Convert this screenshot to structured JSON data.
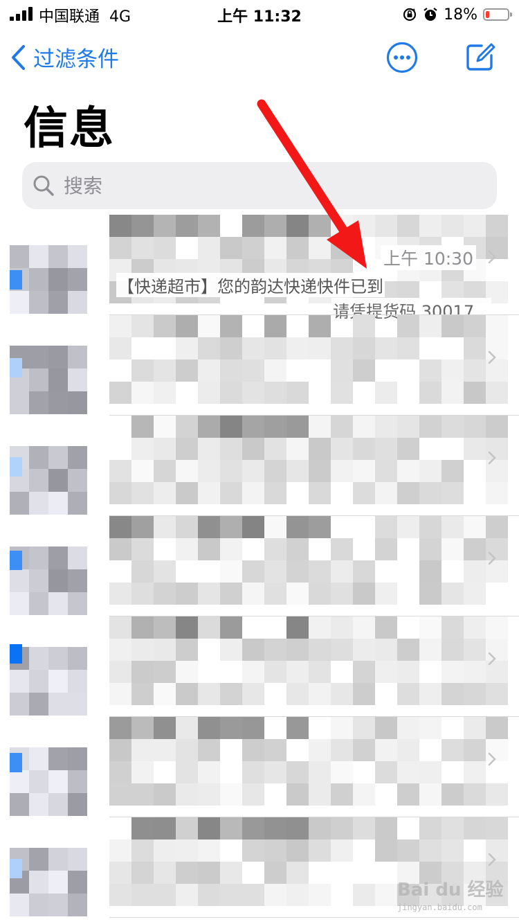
{
  "status_bar": {
    "carrier": "中国联通",
    "network": "4G",
    "time": "上午 11:32",
    "battery_percent": "18%",
    "battery_level": 0.18,
    "battery_color": "#ff3b30"
  },
  "nav": {
    "back_label": "过滤条件",
    "accent_color": "#1f7ae8",
    "more_icon": "ellipsis-circle-icon",
    "compose_icon": "compose-icon"
  },
  "page_title": "信息",
  "search": {
    "placeholder": "搜索"
  },
  "conversations": [
    {
      "time": "上午 10:30",
      "preview_line1": "【快递超市】您的韵达快递快件已到",
      "preview_line2": "请凭提货码 30017..."
    }
  ],
  "watermark": {
    "logo": "Bai du 经验",
    "url": "jingyan.baidu.com"
  }
}
